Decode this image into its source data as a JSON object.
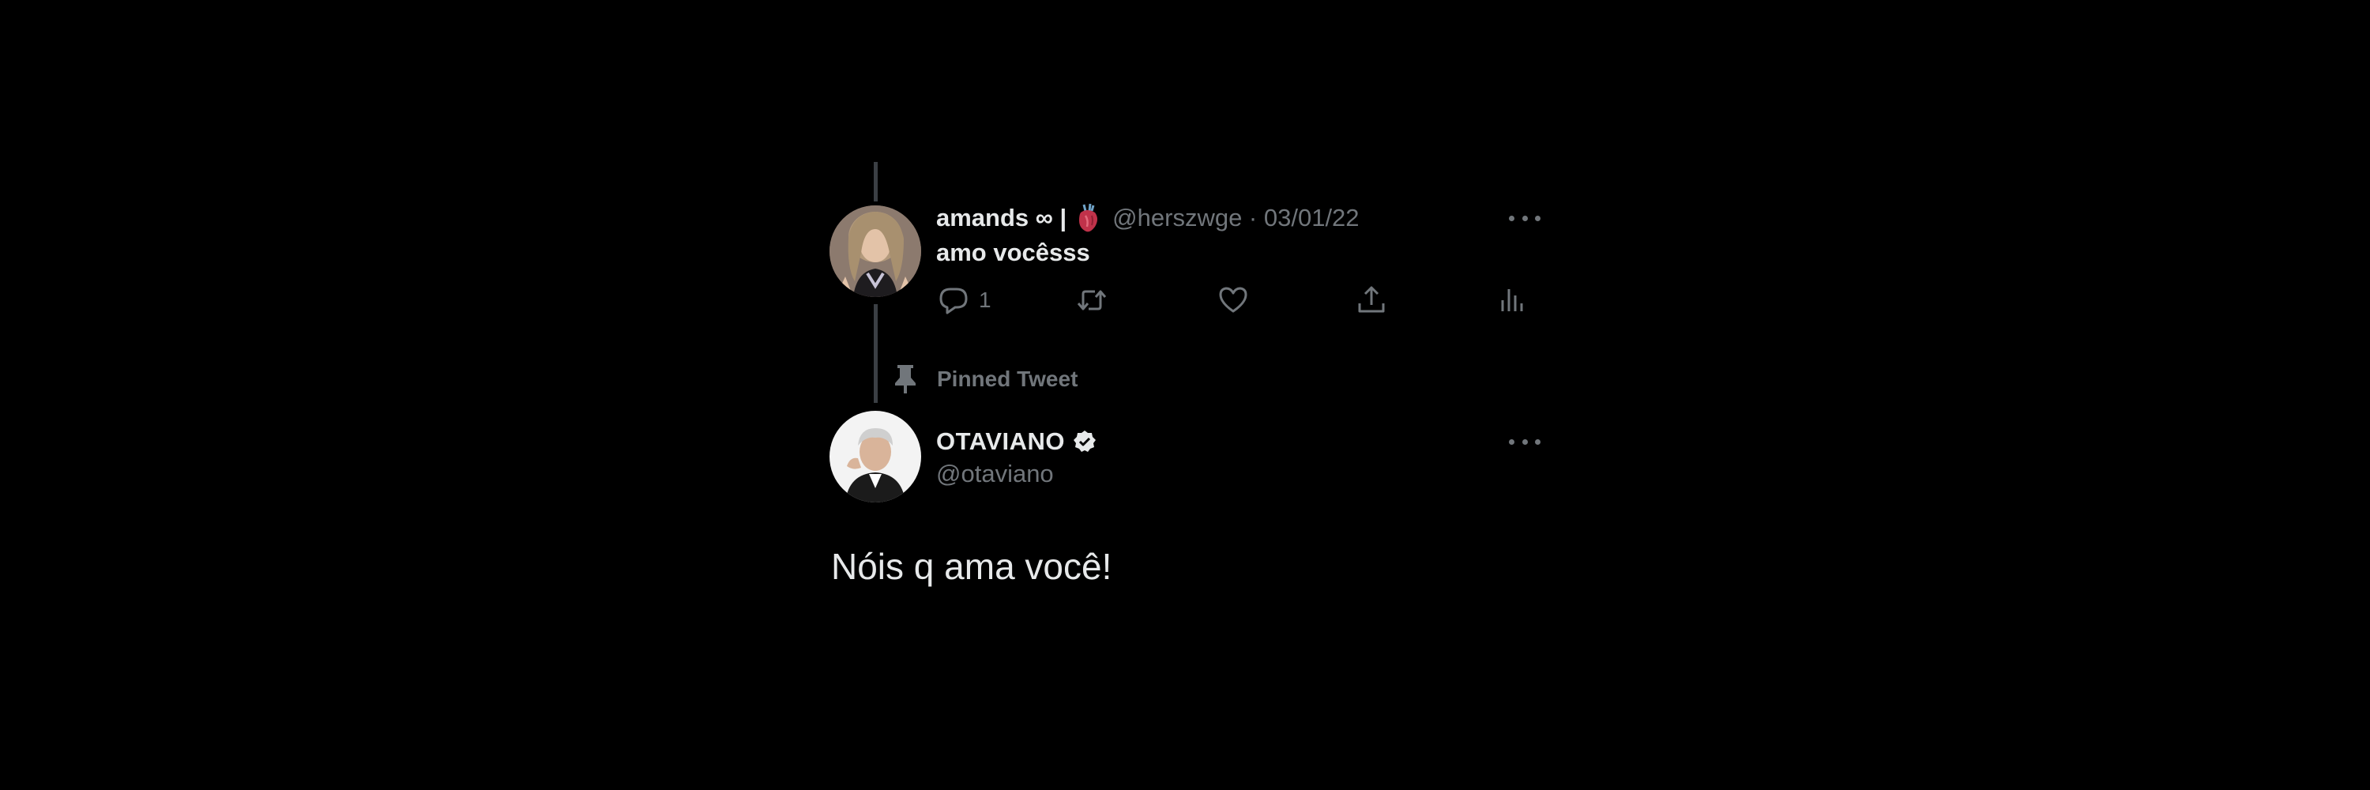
{
  "colors": {
    "background": "#000000",
    "primary_text": "#e7e9ea",
    "secondary_text": "#71767b",
    "thread_line": "#3b3f44"
  },
  "reply_tweet": {
    "display_name": "amands ∞ |",
    "emoji": "anatomical-heart",
    "meta": "@herszwge · 03/01/22",
    "text": "amo vocêsss",
    "reply_count": "1",
    "icons": {
      "more": "more-horizontal-icon",
      "reply": "reply-bubble-icon",
      "retweet": "retweet-icon",
      "like": "heart-outline-icon",
      "share": "share-icon",
      "analytics": "analytics-icon"
    }
  },
  "pinned": {
    "label": "Pinned Tweet",
    "icon": "pin-icon"
  },
  "pinned_tweet": {
    "display_name": "OTAVIANO",
    "verified_icon": "verified-badge-icon",
    "handle": "@otaviano",
    "text": "Nóis q ama você!"
  }
}
